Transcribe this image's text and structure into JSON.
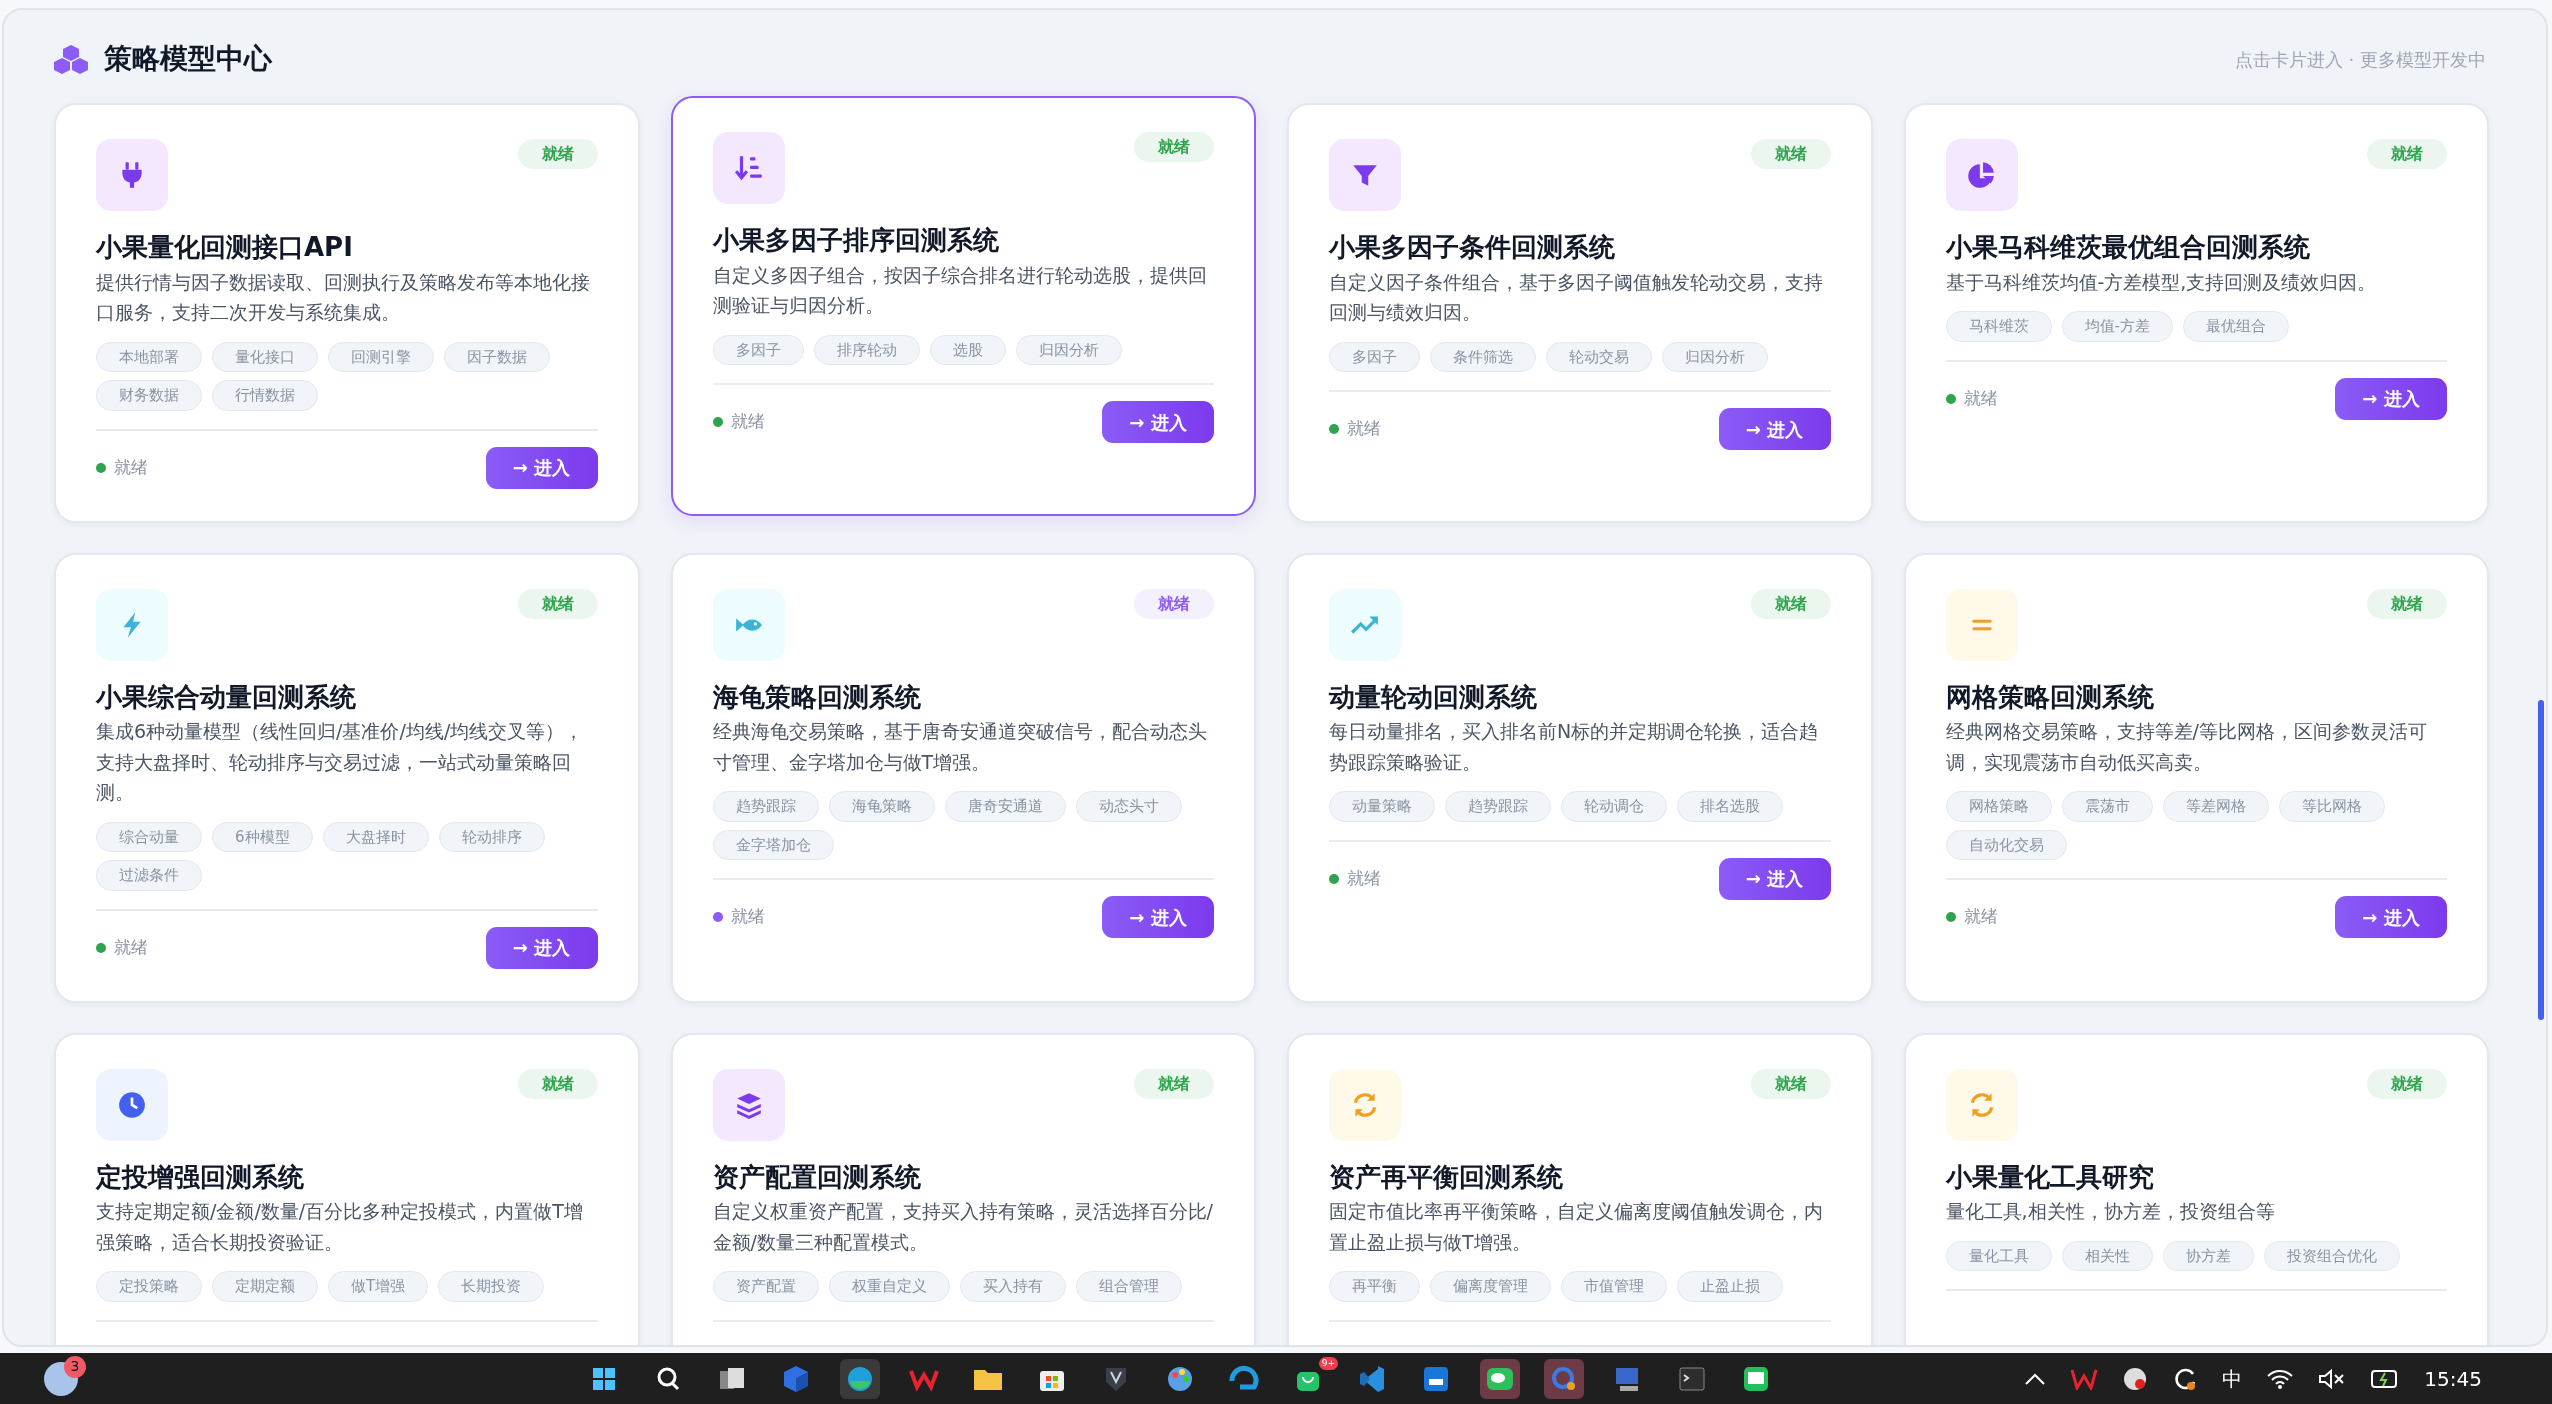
{
  "header": {
    "title": "策略模型中心",
    "hint": "点击卡片进入 · 更多模型开发中"
  },
  "cards": [
    {
      "title": "小果量化回测接口API",
      "description": "提供行情与因子数据读取、回测执行及策略发布等本地化接口服务，支持二次开发与系统集成。",
      "badge": "就绪",
      "color": "#2ea44f",
      "selected": false,
      "tags": [
        "本地部署",
        "量化接口",
        "回测引擎",
        "因子数据",
        "财务数据",
        "行情数据"
      ],
      "status": "就绪",
      "button": "→ 进入"
    },
    {
      "title": "小果多因子排序回测系统",
      "description": "自定义多因子组合，按因子综合排名进行轮动选股，提供回测验证与归因分析。",
      "badge": "就绪",
      "color": "#2ea44f",
      "selected": true,
      "tags": [
        "多因子",
        "排序轮动",
        "选股",
        "归因分析"
      ],
      "status": "就绪",
      "button": "→ 进入"
    },
    {
      "title": "小果多因子条件回测系统",
      "description": "自定义因子条件组合，基于多因子阈值触发轮动交易，支持回测与绩效归因。",
      "badge": "就绪",
      "color": "#2ea44f",
      "selected": false,
      "tags": [
        "多因子",
        "条件筛选",
        "轮动交易",
        "归因分析"
      ],
      "status": "就绪",
      "button": "→ 进入"
    },
    {
      "title": "小果马科维茨最优组合回测系统",
      "description": "基于马科维茨均值-方差模型,支持回测及绩效归因。",
      "badge": "就绪",
      "color": "#2ea44f",
      "selected": false,
      "tags": [
        "马科维茨",
        "均值-方差",
        "最优组合"
      ],
      "status": "就绪",
      "button": "→ 进入"
    },
    {
      "title": "小果综合动量回测系统",
      "description": "集成6种动量模型（线性回归/基准价/均线/均线交叉等），支持大盘择时、轮动排序与交易过滤，一站式动量策略回测。",
      "badge": "就绪",
      "color": "#2ea44f",
      "selected": false,
      "tags": [
        "综合动量",
        "6种模型",
        "大盘择时",
        "轮动排序",
        "过滤条件"
      ],
      "status": "就绪",
      "button": "→ 进入"
    },
    {
      "title": "海龟策略回测系统",
      "description": "经典海龟交易策略，基于唐奇安通道突破信号，配合动态头寸管理、金字塔加仓与做T增强。",
      "badge": "就绪",
      "color": "#8b5cf6",
      "selected": false,
      "tags": [
        "趋势跟踪",
        "海龟策略",
        "唐奇安通道",
        "动态头寸",
        "金字塔加仓"
      ],
      "status": "就绪",
      "button": "→ 进入"
    },
    {
      "title": "动量轮动回测系统",
      "description": "每日动量排名，买入排名前N标的并定期调仓轮换，适合趋势跟踪策略验证。",
      "badge": "就绪",
      "color": "#2ea44f",
      "selected": false,
      "tags": [
        "动量策略",
        "趋势跟踪",
        "轮动调仓",
        "排名选股"
      ],
      "status": "就绪",
      "button": "→ 进入"
    },
    {
      "title": "网格策略回测系统",
      "description": "经典网格交易策略，支持等差/等比网格，区间参数灵活可调，实现震荡市自动低买高卖。",
      "badge": "就绪",
      "color": "#2ea44f",
      "selected": false,
      "tags": [
        "网格策略",
        "震荡市",
        "等差网格",
        "等比网格",
        "自动化交易"
      ],
      "status": "就绪",
      "button": "→ 进入"
    },
    {
      "title": "定投增强回测系统",
      "description": "支持定期定额/金额/数量/百分比多种定投模式，内置做T增强策略，适合长期投资验证。",
      "badge": "就绪",
      "color": "#2ea44f",
      "selected": false,
      "tags": [
        "定投策略",
        "定期定额",
        "做T增强",
        "长期投资"
      ]
    },
    {
      "title": "资产配置回测系统",
      "description": "自定义权重资产配置，支持买入持有策略，灵活选择百分比/金额/数量三种配置模式。",
      "badge": "就绪",
      "color": "#2ea44f",
      "selected": false,
      "tags": [
        "资产配置",
        "权重自定义",
        "买入持有",
        "组合管理"
      ]
    },
    {
      "title": "资产再平衡回测系统",
      "description": "固定市值比率再平衡策略，自定义偏离度阈值触发调仓，内置止盈止损与做T增强。",
      "badge": "就绪",
      "color": "#2ea44f",
      "selected": false,
      "tags": [
        "再平衡",
        "偏离度管理",
        "市值管理",
        "止盈止损"
      ]
    },
    {
      "title": "小果量化工具研究",
      "description": "量化工具,相关性，协方差，投资组合等",
      "badge": "就绪",
      "color": "#2ea44f",
      "selected": false,
      "tags": [
        "量化工具",
        "相关性",
        "协方差",
        "投资组合优化"
      ]
    }
  ],
  "taskbar": {
    "notification_count": "3",
    "store_badge": "9+",
    "input_method": "中",
    "clock": "15:45"
  }
}
